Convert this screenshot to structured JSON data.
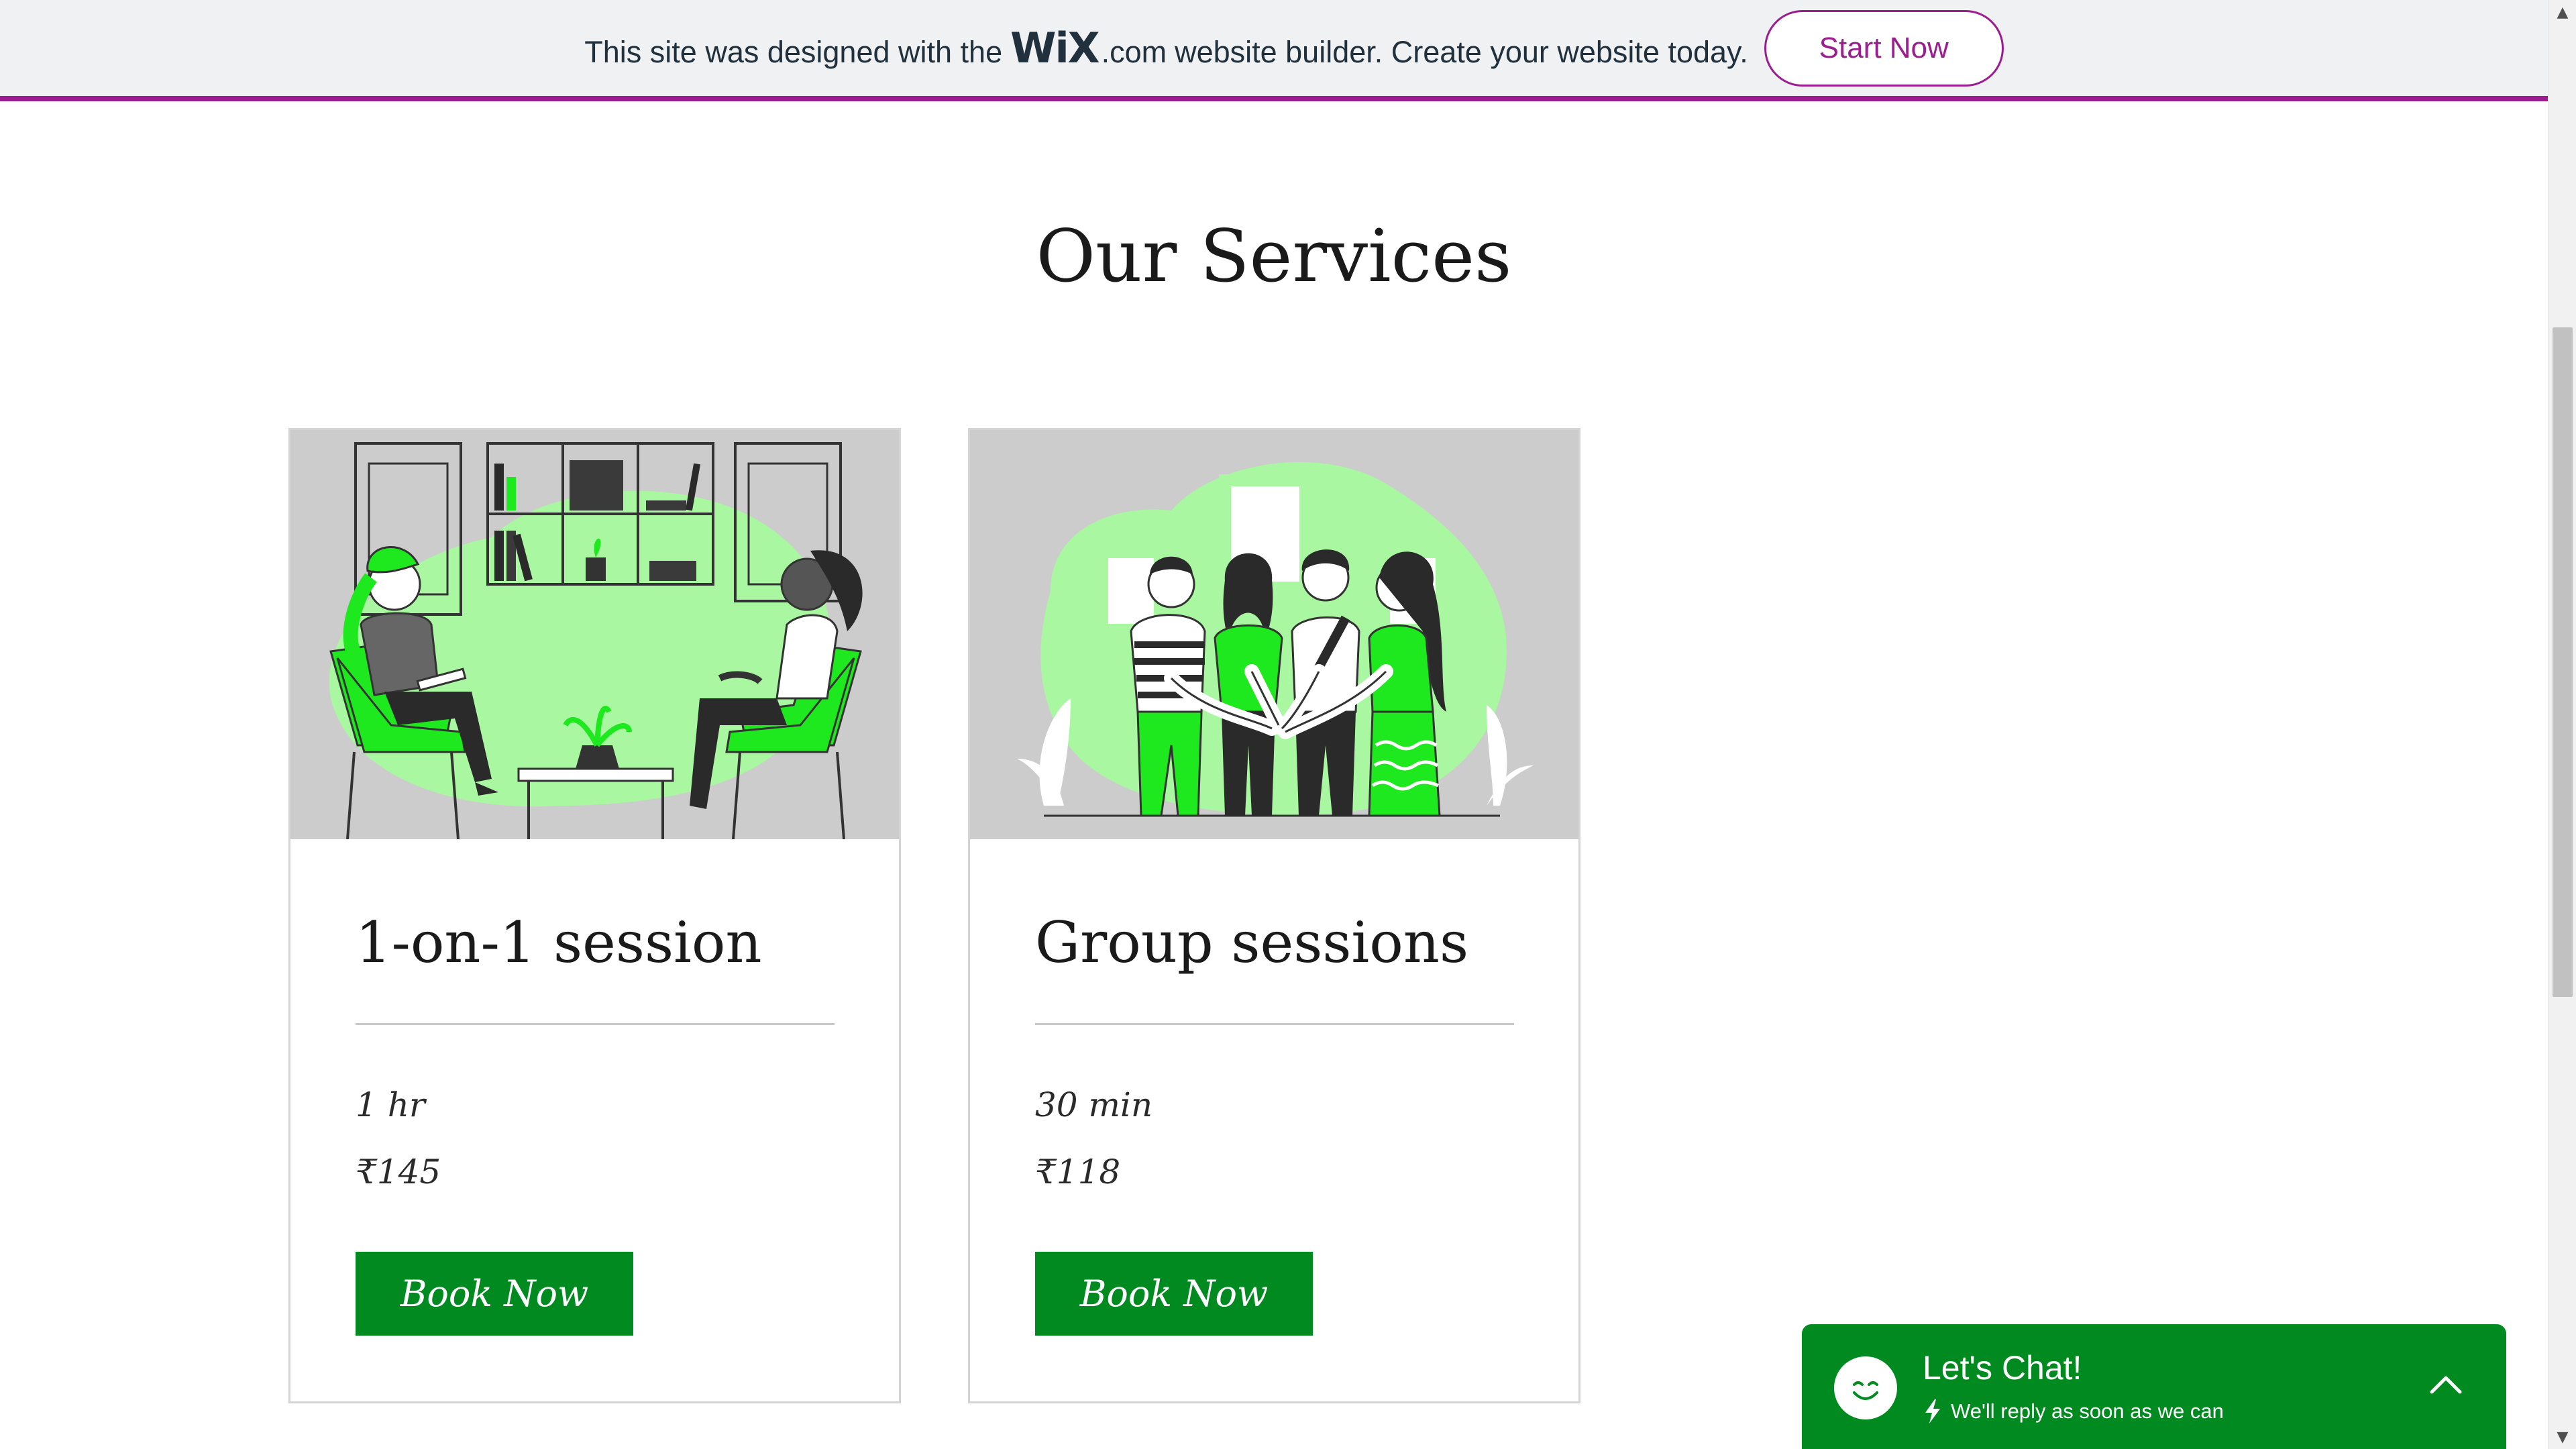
{
  "banner": {
    "text_before": "This site was designed with the",
    "logo": "WiX",
    "domain": ".com",
    "text_after": "website builder. Create your website today.",
    "button_label": "Start Now"
  },
  "section": {
    "title": "Our Services"
  },
  "services": [
    {
      "title": "1-on-1 session",
      "duration": "1 hr",
      "price": "₹145",
      "button_label": "Book Now",
      "image": "counseling-session-illustration"
    },
    {
      "title": "Group sessions",
      "duration": "30 min",
      "price": "₹118",
      "button_label": "Book Now",
      "image": "group-huddle-illustration"
    }
  ],
  "chat": {
    "title": "Let's Chat!",
    "subtitle": "We'll reply as soon as we can",
    "avatar_icon": "smiley-icon",
    "status_icon": "lightning-icon",
    "toggle_icon": "chevron-up-icon"
  },
  "colors": {
    "accent_green": "#008a1f",
    "illustration_green": "#1ee81e",
    "wix_purple": "#9b1d8f",
    "banner_bg": "#eff1f3"
  }
}
